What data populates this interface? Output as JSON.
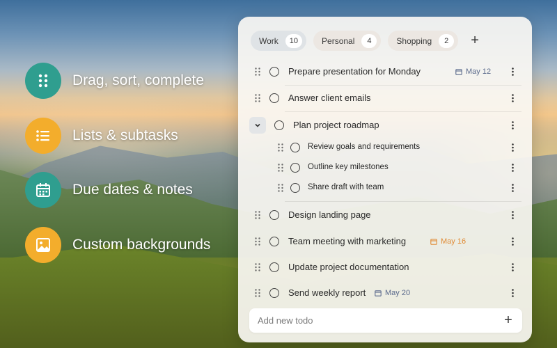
{
  "colors": {
    "feature_teal": "#2f9e8f",
    "feature_amber": "#f3ad2c",
    "due_blue": "#5b6a8c",
    "due_orange": "#e08a35"
  },
  "features": [
    {
      "label": "Drag, sort, complete",
      "icon": "drag-dots-icon",
      "color": "#2f9e8f"
    },
    {
      "label": "Lists & subtasks",
      "icon": "list-icon",
      "color": "#f3ad2c"
    },
    {
      "label": "Due dates & notes",
      "icon": "calendar-icon",
      "color": "#2f9e8f"
    },
    {
      "label": "Custom backgrounds",
      "icon": "image-icon",
      "color": "#f3ad2c"
    }
  ],
  "tabs": [
    {
      "label": "Work",
      "count": "10",
      "active": true
    },
    {
      "label": "Personal",
      "count": "4",
      "active": false
    },
    {
      "label": "Shopping",
      "count": "2",
      "active": false
    }
  ],
  "todos": [
    {
      "text": "Prepare presentation for Monday",
      "due": "May 12",
      "due_color": "blue"
    },
    {
      "text": "Answer client emails"
    },
    {
      "text": "Plan project roadmap",
      "expanded": true
    },
    {
      "text": "Review goals and requirements",
      "subtask": true
    },
    {
      "text": "Outline key milestones",
      "subtask": true
    },
    {
      "text": "Share draft with team",
      "subtask": true
    },
    {
      "text": "Design landing page"
    },
    {
      "text": "Team meeting with marketing",
      "due": "May 16",
      "due_color": "orange"
    },
    {
      "text": "Update project documentation"
    },
    {
      "text": "Send weekly report",
      "due": "May 20",
      "due_color": "blue"
    }
  ],
  "add_todo": {
    "placeholder": "Add new todo"
  }
}
